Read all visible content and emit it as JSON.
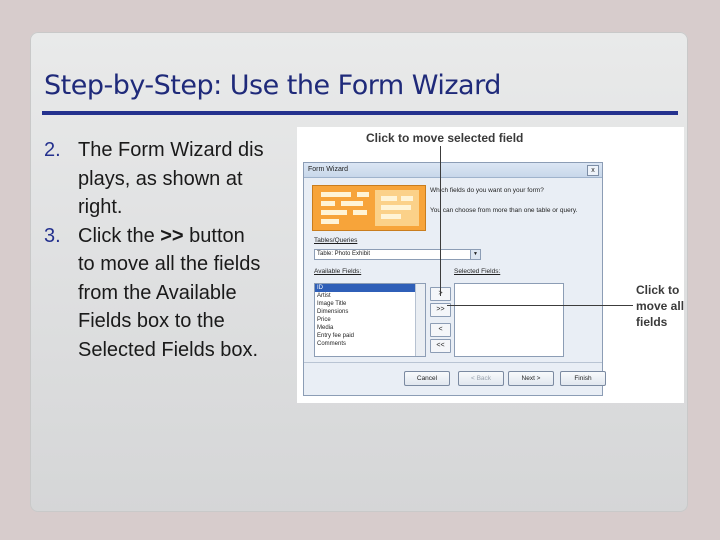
{
  "slide": {
    "title": "Step-by-Step: Use the Form Wizard",
    "bullets": [
      {
        "num": "2.",
        "lines": [
          "The Form Wizard dis",
          "plays, as shown at",
          "right."
        ]
      },
      {
        "num": "3.",
        "pre": "Click the ",
        "bold": ">>",
        "post": " button",
        "lines": [
          "to move all the fields",
          "from the Available",
          "Fields box to the",
          "Selected Fields box."
        ]
      }
    ]
  },
  "callouts": {
    "top": "Click to move selected field",
    "right": [
      "Click to",
      "move all",
      "fields"
    ]
  },
  "dialog": {
    "title": "Form Wizard",
    "close": "x",
    "question": "Which fields do you want on your form?",
    "hint": "You can choose from more than one table or query.",
    "tables_label": "Tables/Queries",
    "table_value": "Table: Photo Exhibit",
    "available_label": "Available Fields:",
    "selected_label": "Selected Fields:",
    "available_fields": [
      "ID",
      "Artist",
      "Image Title",
      "Dimensions",
      "Price",
      "Media",
      "Entry fee paid",
      "Comments"
    ],
    "move_buttons": [
      ">",
      ">>",
      "<",
      "<<"
    ],
    "buttons": {
      "cancel": "Cancel",
      "back": "< Back",
      "next": "Next >",
      "finish": "Finish"
    }
  }
}
